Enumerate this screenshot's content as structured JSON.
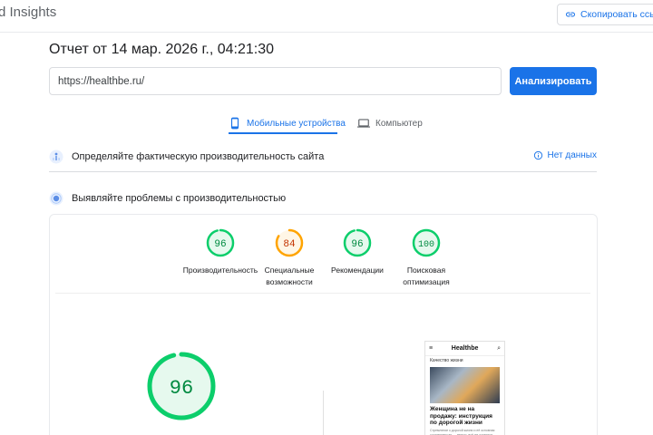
{
  "header": {
    "app_title": "d Insights",
    "copy_link_label": "Скопировать ссылк"
  },
  "report": {
    "title": "Отчет от 14 мар. 2026 г., 04:21:30"
  },
  "url_input": {
    "value": "https://healthbe.ru/"
  },
  "analyze_button": "Анализировать",
  "tabs": [
    {
      "label": "Мобильные устройства",
      "icon": "smartphone-icon",
      "active": true
    },
    {
      "label": "Компьютер",
      "icon": "laptop-icon",
      "active": false
    }
  ],
  "sections": {
    "field_data": {
      "label": "Определяйте фактическую производительность сайта",
      "status": "Нет данных"
    },
    "lab_data": {
      "label": "Выявляйте проблемы с производительностью"
    }
  },
  "scores": [
    {
      "name": "score-performance",
      "value": "96",
      "label": "Производительность",
      "label2": "",
      "level": 0.96,
      "color": "#0cce6b",
      "fill": "#e6f9ee",
      "text": "#008a40"
    },
    {
      "name": "score-accessibility",
      "value": "84",
      "label": "Специальные",
      "label2": "возможности",
      "level": 0.84,
      "color": "#ffa400",
      "fill": "#fff6e6",
      "text": "#c33300"
    },
    {
      "name": "score-best-practices",
      "value": "96",
      "label": "Рекомендации",
      "label2": "",
      "level": 0.96,
      "color": "#0cce6b",
      "fill": "#e6f9ee",
      "text": "#008a40"
    },
    {
      "name": "score-seo",
      "value": "100",
      "label": "Поисковая",
      "label2": "оптимизация",
      "level": 1.0,
      "color": "#0cce6b",
      "fill": "#e6f9ee",
      "text": "#008a40"
    }
  ],
  "main_score": {
    "value": "96",
    "level": 0.96,
    "color": "#0cce6b",
    "fill": "#e6f9ee",
    "text": "#008a40"
  },
  "preview": {
    "brand": "Healthbe",
    "category": "Качество жизни",
    "headline": "Женщина не на продажу: инструкция по дорогой жизни",
    "body": "Стремление к дорогой жизни и её основная составляющая — деньги, всё же остаются одним из…"
  }
}
